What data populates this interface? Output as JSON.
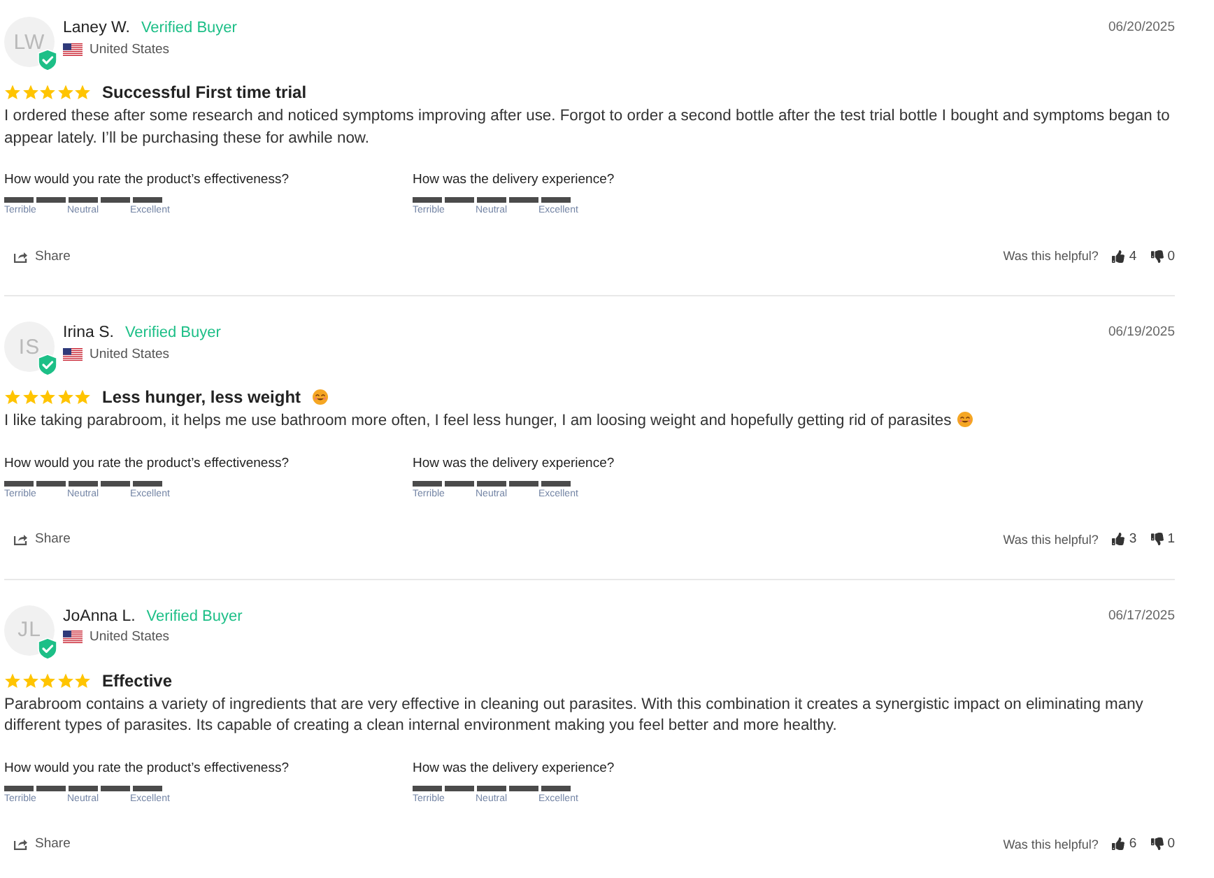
{
  "reviews": [
    {
      "initials": "LW",
      "verified": true,
      "name": "Laney W.",
      "badge": "Verified Buyer",
      "country": "United States",
      "date": "06/20/2025",
      "stars": 5,
      "title": "Successful First time trial",
      "body": "I ordered these after some research and noticed symptoms improving after use. Forgot to order a second bottle after the test trial bottle I bought and symptoms began to appear lately. I’ll be purchasing these for awhile now.",
      "questions": [
        {
          "label": "How would you rate the product’s effectiveness?",
          "level": 1,
          "scale": [
            "Terrible",
            "Neutral",
            "Excellent"
          ]
        },
        {
          "label": "How was the delivery experience?",
          "level": 1,
          "scale": [
            "Terrible",
            "Neutral",
            "Excellent"
          ]
        }
      ],
      "share": "Share",
      "helpful_prompt": "Was this helpful?",
      "up_votes": "4",
      "down_votes": "0"
    },
    {
      "initials": "IS",
      "verified": true,
      "name": "Irina S.",
      "badge": "Verified Buyer",
      "country": "United States",
      "date": "06/19/2025",
      "stars": 5,
      "title": "Less hunger, less weight",
      "title_emoji": true,
      "body": "I like taking parabroom, it helps me use bathroom more often, I feel less hunger, I am loosing weight and hopefully getting rid of parasites",
      "body_emoji": true,
      "questions": [
        {
          "label": "How would you rate the product’s effectiveness?",
          "level": 1,
          "scale": [
            "Terrible",
            "Neutral",
            "Excellent"
          ]
        },
        {
          "label": "How was the delivery experience?",
          "level": 1,
          "scale": [
            "Terrible",
            "Neutral",
            "Excellent"
          ]
        }
      ],
      "share": "Share",
      "helpful_prompt": "Was this helpful?",
      "up_votes": "3",
      "down_votes": "1"
    },
    {
      "initials": "JL",
      "verified": true,
      "name": "JoAnna L.",
      "badge": "Verified Buyer",
      "country": "United States",
      "date": "06/17/2025",
      "stars": 5,
      "title": "Effective",
      "body": "Parabroom contains a variety of ingredients that are very effective in cleaning out parasites. With this combination it creates a synergistic impact on eliminating many different types of parasites. Its capable of creating a clean internal environment making you feel better and more healthy.",
      "questions": [
        {
          "label": "How would you rate the product’s effectiveness?",
          "level": 1,
          "scale": [
            "Terrible",
            "Neutral",
            "Excellent"
          ]
        },
        {
          "label": "How was the delivery experience?",
          "level": 1,
          "scale": [
            "Terrible",
            "Neutral",
            "Excellent"
          ]
        }
      ],
      "share": "Share",
      "helpful_prompt": "Was this helpful?",
      "up_votes": "6",
      "down_votes": "0"
    }
  ]
}
